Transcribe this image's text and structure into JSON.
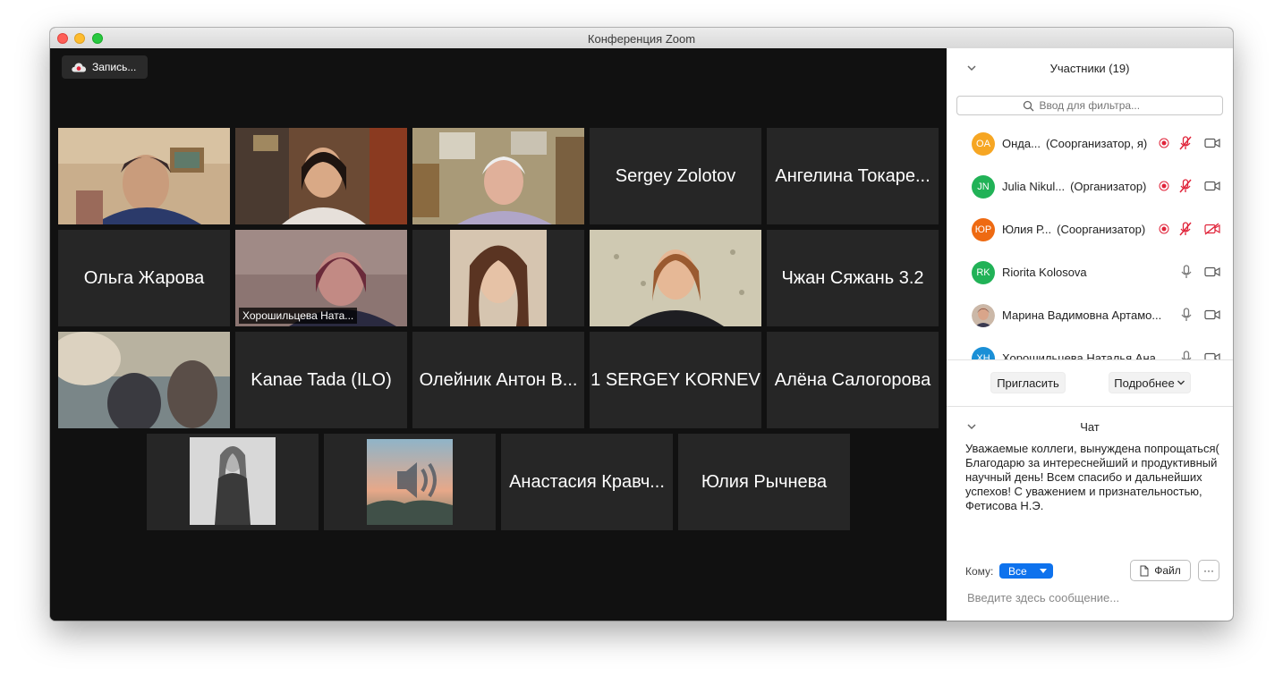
{
  "window": {
    "title": "Конференция Zoom"
  },
  "toolbar": {
    "record_label": "Запись..."
  },
  "tiles": [
    {
      "name": "",
      "type": "video"
    },
    {
      "name": "",
      "type": "video"
    },
    {
      "name": "",
      "type": "video"
    },
    {
      "name": "Sergey Zolotov",
      "type": "name"
    },
    {
      "name": "Ангелина Токаре...",
      "type": "name"
    },
    {
      "name": "Ольга Жарова",
      "type": "name"
    },
    {
      "name": "Хорошильцева Ната...",
      "type": "video",
      "active": true
    },
    {
      "name": "",
      "type": "photo"
    },
    {
      "name": "",
      "type": "video"
    },
    {
      "name": "Чжан Сяжань 3.2",
      "type": "name"
    },
    {
      "name": "",
      "type": "video"
    },
    {
      "name": "Kanae Tada (ILO)",
      "type": "name"
    },
    {
      "name": "Олейник Антон В...",
      "type": "name"
    },
    {
      "name": "1 SERGEY KORNEV",
      "type": "name"
    },
    {
      "name": "Алёна Салогорова",
      "type": "name"
    },
    {
      "name": "",
      "type": "photo"
    },
    {
      "name": "",
      "type": "photo"
    },
    {
      "name": "Анастасия Кравч...",
      "type": "name"
    },
    {
      "name": "Юлия Рычнева",
      "type": "name"
    }
  ],
  "participants": {
    "title": "Участники (19)",
    "filter_placeholder": "Ввод для фильтра...",
    "list": [
      {
        "initials": "OA",
        "color": "#f6a623",
        "name": "Онда...",
        "role": "(Соорганизатор, я)",
        "recording": true,
        "mic": "muted",
        "video": "on"
      },
      {
        "initials": "JN",
        "color": "#21b257",
        "name": "Julia Nikul...",
        "role": "(Организатор)",
        "recording": true,
        "mic": "muted",
        "video": "on"
      },
      {
        "initials": "ЮР",
        "color": "#ee6a12",
        "name": "Юлия Р...",
        "role": "(Соорганизатор)",
        "recording": true,
        "mic": "muted",
        "video": "off"
      },
      {
        "initials": "RK",
        "color": "#21b257",
        "name": "Riorita Kolosova",
        "role": "",
        "recording": false,
        "mic": "on",
        "video": "on"
      },
      {
        "initials": "",
        "color": "#7a5a4a",
        "name": "Марина Вадимовна Артамо...",
        "role": "",
        "recording": false,
        "mic": "on",
        "video": "on"
      },
      {
        "initials": "ХН",
        "color": "#1a8fd6",
        "name": "Хорошильцева Наталья Ана...",
        "role": "",
        "recording": false,
        "mic": "on",
        "video": "on"
      }
    ],
    "invite_label": "Пригласить",
    "more_label": "Подробнее"
  },
  "chat": {
    "title": "Чат",
    "message": "Уважаемые коллеги, вынуждена попрощаться(  Благодарю за интереснейший и продуктивный научный день! Всем спасибо и дальнейших успехов! С уважением и признательностью, Фетисова Н.Э.",
    "to_label": "Кому:",
    "to_value": "Все",
    "file_label": "Файл",
    "more_label": "···",
    "input_placeholder": "Введите здесь сообщение..."
  }
}
